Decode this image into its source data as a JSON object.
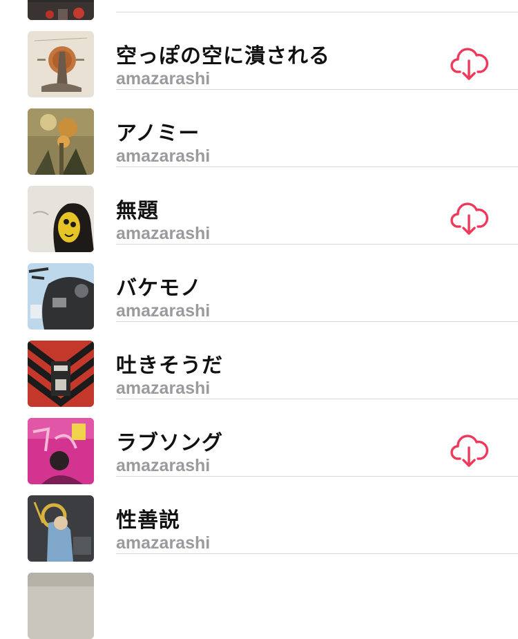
{
  "accent_color": "#f0385a",
  "songs": [
    {
      "title": "",
      "artist": "",
      "artwork": "art-partial-top",
      "download": false
    },
    {
      "title": "空っぽの空に潰される",
      "artist": "amazarashi",
      "artwork": "art-beige-figure",
      "download": true
    },
    {
      "title": "アノミー",
      "artist": "amazarashi",
      "artwork": "art-olive-flower",
      "download": false
    },
    {
      "title": "無題",
      "artist": "amazarashi",
      "artwork": "art-yellow-face",
      "download": true
    },
    {
      "title": "バケモノ",
      "artist": "amazarashi",
      "artwork": "art-blue-collage",
      "download": false
    },
    {
      "title": "吐きそうだ",
      "artist": "amazarashi",
      "artwork": "art-red-stripes",
      "download": false
    },
    {
      "title": "ラブソング",
      "artist": "amazarashi",
      "artwork": "art-pink-lovesong",
      "download": true
    },
    {
      "title": "性善説",
      "artist": "amazarashi",
      "artwork": "art-dark-portrait",
      "download": false
    },
    {
      "title": "",
      "artist": "",
      "artwork": "art-partial-bottom",
      "download": false
    }
  ]
}
